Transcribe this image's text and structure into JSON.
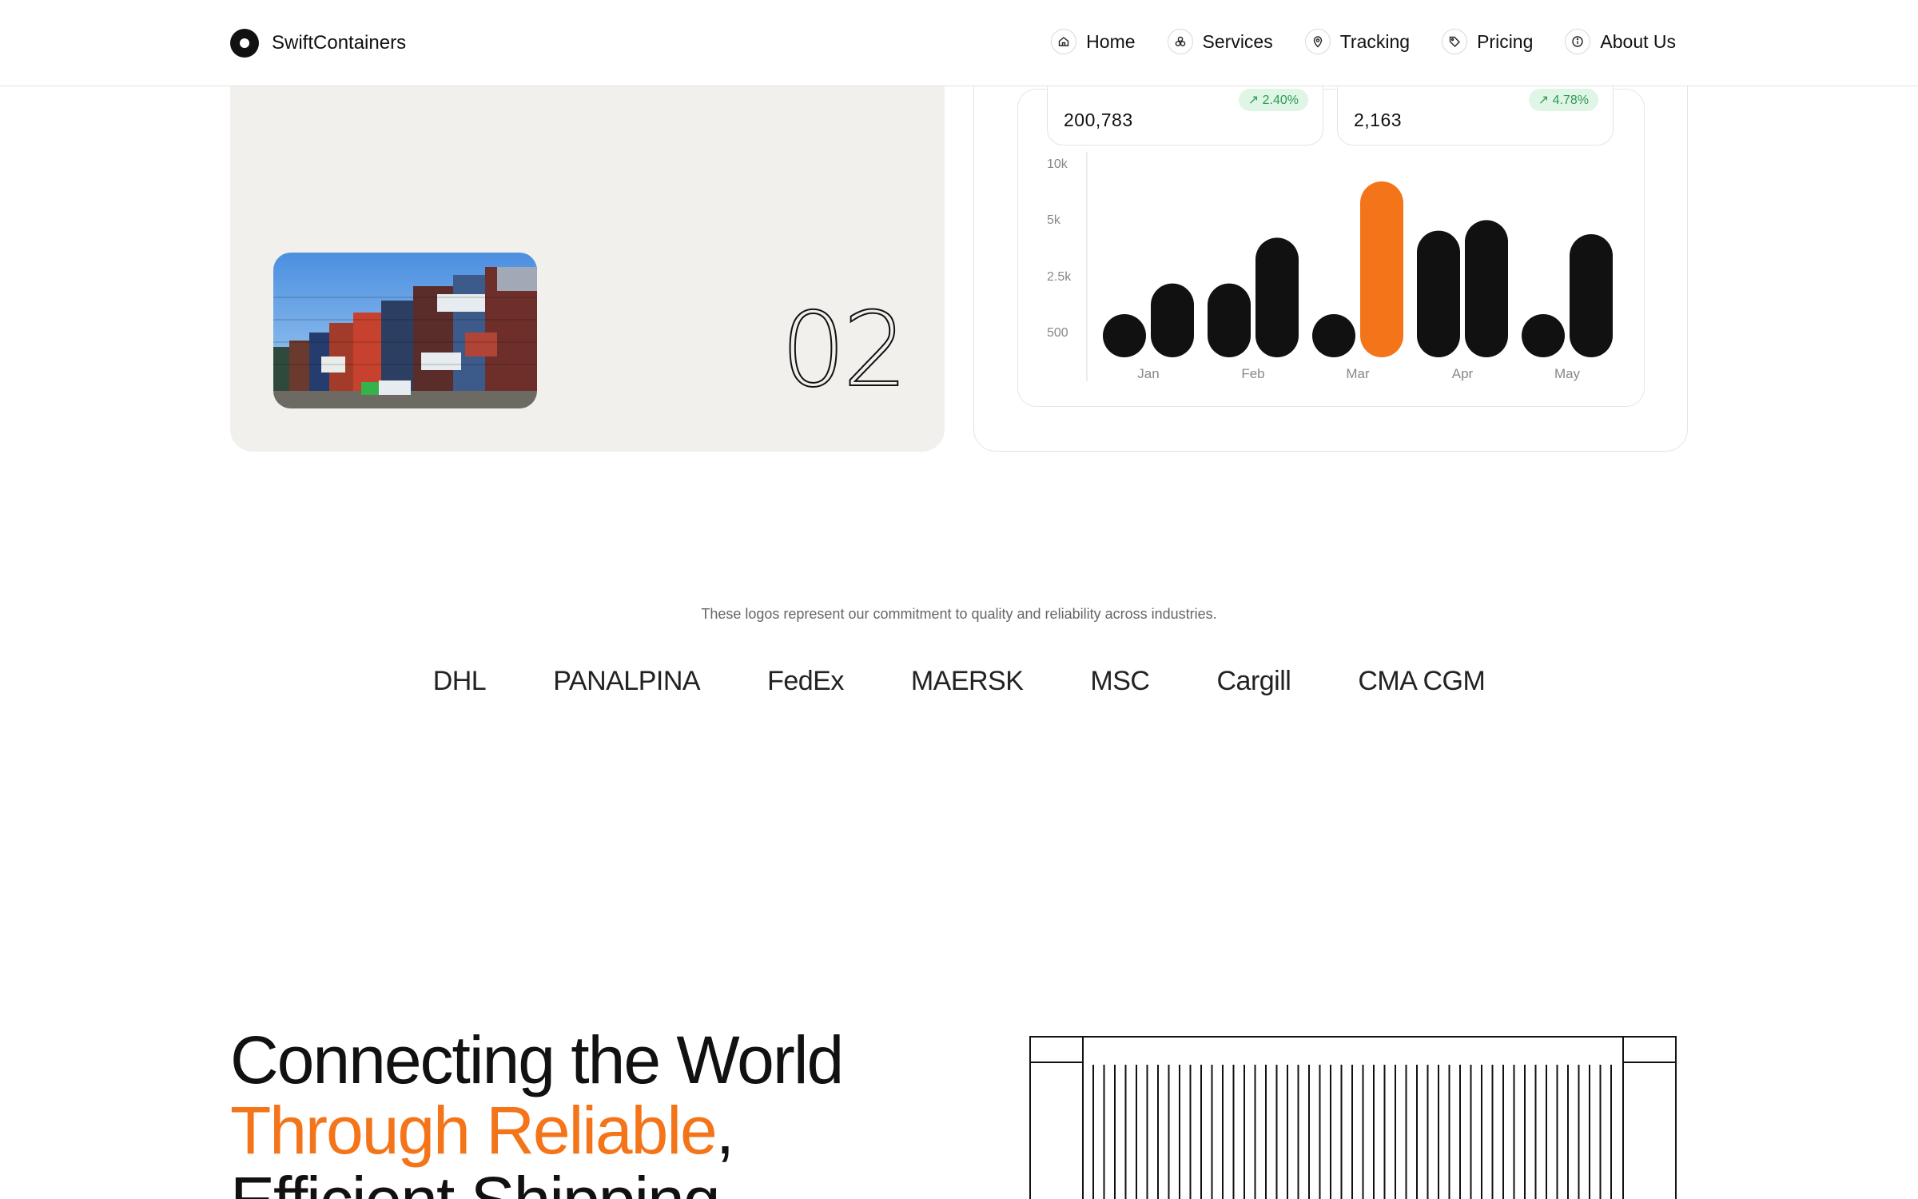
{
  "nav": {
    "brand": "SwiftContainers",
    "links": [
      {
        "label": "Home",
        "icon": "home-icon"
      },
      {
        "label": "Services",
        "icon": "services-icon"
      },
      {
        "label": "Tracking",
        "icon": "location-pin-icon"
      },
      {
        "label": "Pricing",
        "icon": "tag-icon"
      },
      {
        "label": "About Us",
        "icon": "info-icon"
      }
    ]
  },
  "card_left": {
    "number": "02",
    "photo": "container-stack-photo"
  },
  "stats": [
    {
      "value": "200,783",
      "change": "↗ 2.40%"
    },
    {
      "value": "2,163",
      "change": "↗ 4.78%"
    }
  ],
  "chart_data": {
    "type": "bar",
    "categories": [
      "Jan",
      "Feb",
      "Mar",
      "Apr",
      "May"
    ],
    "series": [
      {
        "values": [
          1800,
          4200,
          800,
          7200,
          1900
        ]
      },
      {
        "values": [
          4200,
          6800,
          10000,
          7800,
          7000
        ]
      }
    ],
    "highlight": {
      "category": "Mar",
      "series_index": 1,
      "color": "#f47419"
    },
    "bar_color": "#111111",
    "y_ticks": [
      "10k",
      "5k",
      "2.5k",
      "500"
    ],
    "ylim": [
      0,
      10000
    ]
  },
  "logos": {
    "tagline": "These logos represent our commitment to quality and reliability across industries.",
    "brands": [
      "DHL",
      "PANALPINA",
      "FedEx",
      "MAERSK",
      "MSC",
      "Cargill",
      "CMA CGM"
    ]
  },
  "hero": {
    "line1": "Connecting the World",
    "line2_accent": "Through Reliable",
    "line2_rest": ",",
    "line3": "Efficient Shipping"
  },
  "colors": {
    "accent": "#f47419",
    "dark": "#111111",
    "card_bg": "#f1f0ed",
    "badge_bg": "#dff5e5",
    "badge_text": "#2e9a52"
  }
}
